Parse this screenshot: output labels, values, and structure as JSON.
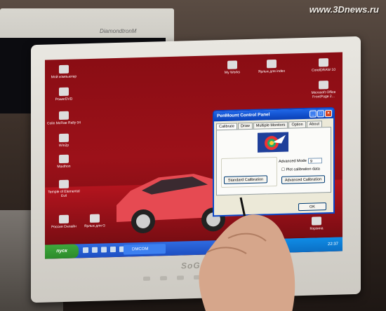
{
  "watermark": "www.3Dnews.ru",
  "background_monitor": {
    "brand": "DiamondtronM"
  },
  "monitor": {
    "brand": "SoGo"
  },
  "desktop": {
    "icons_left": [
      {
        "label": "Мой компьютер"
      },
      {
        "label": "PowerDVD"
      },
      {
        "label": "Colin McRae Rally 04"
      },
      {
        "label": "Win2p"
      },
      {
        "label": "Maxthon"
      },
      {
        "label": "Temple of Elemental Evil"
      },
      {
        "label": "Россия Онлайн"
      },
      {
        "label": "Ярлык для G"
      }
    ],
    "icons_top": [
      {
        "label": "My Works"
      },
      {
        "label": "Ярлык для index"
      },
      {
        "label": "CorelDRAW 10"
      },
      {
        "label": "Microsoft Office FrontPage 2..."
      }
    ],
    "trash_label": "Корзина"
  },
  "taskbar": {
    "start_label": "пуск",
    "task_item_label": "DMCOM",
    "clock": "22:37"
  },
  "dialog": {
    "title": "PenMount Control Panel",
    "tabs": [
      "Calibrate",
      "Draw",
      "Multiple Monitors",
      "Option",
      "About"
    ],
    "active_tab": "Calibrate",
    "advanced_mode_label": "Advanced Mode",
    "advanced_mode_value": "9",
    "plot_label": "Plot calibration data",
    "standard_button": "Standard Calibration",
    "advanced_button": "Advanced Calibration",
    "ok_button": "OK",
    "title_buttons": {
      "minimize": "_",
      "maximize": "□",
      "close": "×"
    }
  }
}
